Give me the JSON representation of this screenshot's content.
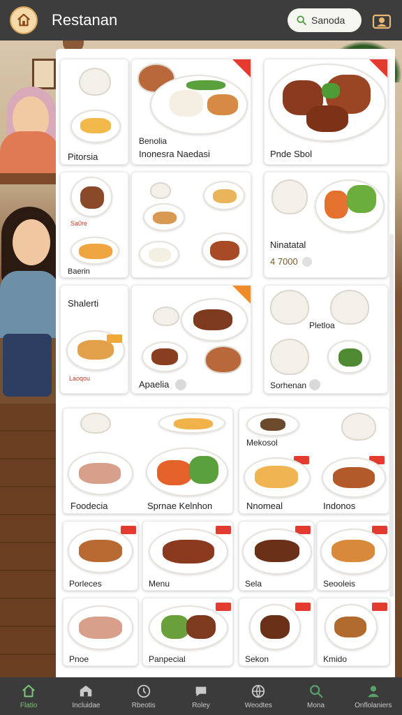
{
  "header": {
    "title": "Restanan",
    "search_label": "Sanoda"
  },
  "cards": {
    "c1": {
      "label": "Pitorsia"
    },
    "c2": {
      "label_top": "Benolia",
      "label": "Inonesra Naedasi"
    },
    "c3": {
      "label": "Pnde Sbol"
    },
    "c4": {
      "small_1": "Sa0re",
      "label": "Baerin"
    },
    "c6": {
      "label": "Ninatatal",
      "price": "4 7000"
    },
    "c7": {
      "label": "Shalerti",
      "small_1": "Laoqou"
    },
    "c8": {
      "label": "Apaelia"
    },
    "c9": {
      "label_top": "Pletloa",
      "label": "Sorhenan"
    },
    "c10": {
      "label_1": "Foodecia",
      "label_2": "Sprnae Kelnhon"
    },
    "c11": {
      "label_top": "Mekosol",
      "label_1": "Nnomeal",
      "label_2": "Indonos"
    },
    "c12": {
      "label": "Porleces"
    },
    "c13": {
      "label": "Menu"
    },
    "c14": {
      "label": "Sela"
    },
    "c15": {
      "label": "Seooleis"
    },
    "c16": {
      "label": "Pnoe"
    },
    "c17": {
      "label": "Panpecial"
    },
    "c18": {
      "label": "Sekon"
    },
    "c19": {
      "label": "Kmido"
    }
  },
  "bottom_nav": {
    "items": [
      {
        "label": "Flatio",
        "icon": "home-icon",
        "active": true
      },
      {
        "label": "Incluidae",
        "icon": "store-icon",
        "active": false
      },
      {
        "label": "Rbeotis",
        "icon": "clock-icon",
        "active": false
      },
      {
        "label": "Roley",
        "icon": "chat-icon",
        "active": false
      },
      {
        "label": "Weodtes",
        "icon": "globe-icon",
        "active": false
      },
      {
        "label": "Mona",
        "icon": "search-icon",
        "active": false
      },
      {
        "label": "Onflolaniers",
        "icon": "user-icon",
        "active": false
      }
    ]
  },
  "colors": {
    "header_bg": "#3d3d3d",
    "accent_red": "#e33b2f",
    "nav_active": "#7cc576"
  }
}
